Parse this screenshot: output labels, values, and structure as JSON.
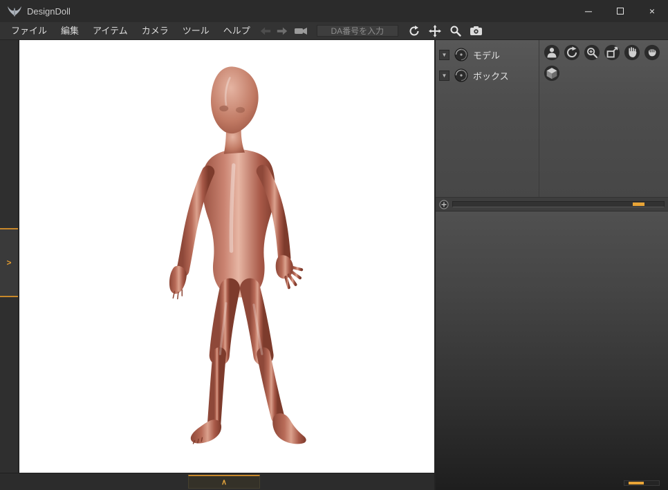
{
  "window": {
    "title": "DesignDoll",
    "controls": {
      "minimize": "─",
      "close": "×"
    }
  },
  "menubar": {
    "items": [
      "ファイル",
      "編集",
      "アイテム",
      "カメラ",
      "ツール",
      "ヘルプ"
    ]
  },
  "toolbar": {
    "da_input_placeholder": "DA番号を入力",
    "da_input_value": ""
  },
  "viewport": {
    "side_tab_chevron": ">",
    "expand_caret": "∧"
  },
  "right_panel": {
    "dropdown_glyph": "▼",
    "tree": [
      {
        "label": "モデル"
      },
      {
        "label": "ボックス"
      }
    ]
  },
  "colors": {
    "accent": "#E09A30",
    "skin_mid": "#C07763",
    "panel": "#4A4A4A",
    "canvas": "#FFFFFF"
  }
}
